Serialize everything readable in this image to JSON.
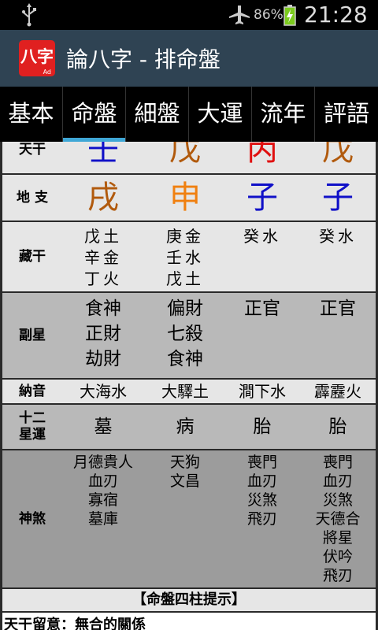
{
  "status": {
    "battery_pct": "86%",
    "time": "21:28"
  },
  "app": {
    "logo_text": "八字",
    "logo_badge": "Ad",
    "title": "論八字 - 排命盤"
  },
  "tabs": [
    "基本",
    "命盤",
    "細盤",
    "大運",
    "流年",
    "評語"
  ],
  "selected_tab": "命盤",
  "chart": {
    "stem": {
      "label": "天干",
      "values": [
        "壬",
        "戊",
        "丙",
        "戊"
      ],
      "colors": [
        "#1010c8",
        "#b15a0d",
        "#e01010",
        "#b15a0d"
      ]
    },
    "branch": {
      "label": "地 支",
      "values": [
        "戌",
        "申",
        "子",
        "子"
      ],
      "colors": [
        "#b15a0d",
        "#f08010",
        "#1010c8",
        "#1010c8"
      ]
    },
    "hidden": {
      "label": "藏干",
      "values": [
        [
          "戊土",
          "辛金",
          "丁火"
        ],
        [
          "庚金",
          "壬水",
          "戊土"
        ],
        [
          "癸水"
        ],
        [
          "癸水"
        ]
      ]
    },
    "sub_star": {
      "label": "副星",
      "values": [
        [
          "食神",
          "正財",
          "劫財"
        ],
        [
          "偏財",
          "七殺",
          "食神"
        ],
        [
          "正官"
        ],
        [
          "正官"
        ]
      ]
    },
    "nayin": {
      "label": "納音",
      "values": [
        "大海水",
        "大驛土",
        "澗下水",
        "霹靂火"
      ]
    },
    "stage": {
      "label": "十二星運",
      "label_lines": [
        "十二",
        "星運"
      ],
      "values": [
        "墓",
        "病",
        "胎",
        "胎"
      ]
    },
    "shensha": {
      "label": "神煞",
      "values": [
        [
          "月德貴人",
          "血刃",
          "寡宿",
          "墓庫"
        ],
        [
          "天狗",
          "文昌"
        ],
        [
          "喪門",
          "血刃",
          "災煞",
          "飛刃"
        ],
        [
          "喪門",
          "血刃",
          "災煞",
          "天德合",
          "將星",
          "伏吟",
          "飛刃"
        ]
      ]
    }
  },
  "hint": {
    "title": "【命盤四柱提示】",
    "note": "天干留意：無合的關係"
  }
}
